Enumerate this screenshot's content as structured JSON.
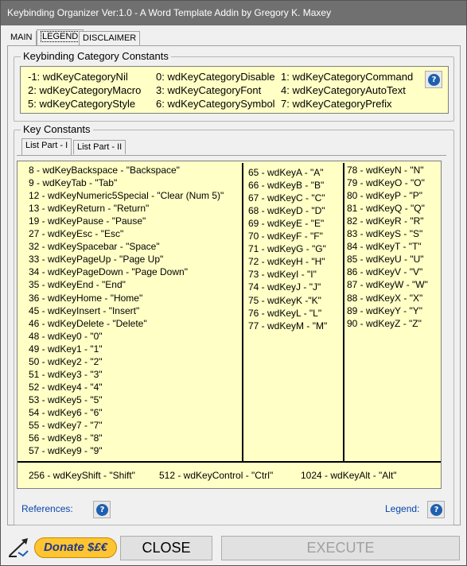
{
  "window": {
    "title": "Keybinding Organizer Ver:1.0 - A Word Template Addin by Gregory K. Maxey"
  },
  "tabs": [
    "MAIN",
    "LEGEND",
    "DISCLAIMER"
  ],
  "category_group": {
    "title": "Keybinding Category Constants",
    "items": [
      "-1: wdKeyCategoryNil",
      "0: wdKeyCategoryDisable",
      "1: wdKeyCategoryCommand",
      "2: wdKeyCategoryMacro",
      "3: wdKeyCategoryFont",
      "4: wdKeyCategoryAutoText",
      "5: wdKeyCategoryStyle",
      "6: wdKeyCategorySymbol",
      "7: wdKeyCategoryPrefix"
    ]
  },
  "key_group": {
    "title": "Key Constants",
    "subtabs": [
      "List Part - I",
      "List Part - II"
    ],
    "col1": [
      "8 - wdKeyBackspace - \"Backspace\"",
      "9 - wdKeyTab - \"Tab\"",
      "12 - wdKeyNumeric5Special - \"Clear (Num 5)\"",
      "13 - wdKeyReturn - \"Return\"",
      "19 - wdKeyPause - \"Pause\"",
      "27 - wdKeyEsc - \"Esc\"",
      "32 - wdKeySpacebar - \"Space\"",
      "33 - wdKeyPageUp - \"Page Up\"",
      "34 - wdKeyPageDown - \"Page Down\"",
      "35 - wdKeyEnd - \"End\"",
      "36 - wdKeyHome - \"Home\"",
      "45 - wdKeyInsert - \"Insert\"",
      "46 - wdKeyDelete - \"Delete\"",
      "48 - wdKey0 - \"0\"",
      "49 - wdKey1 - \"1\"",
      "50 - wdKey2 - \"2\"",
      "51 - wdKey3 - \"3\"",
      "52 - wdKey4 - \"4\"",
      "53 - wdKey5 - \"5\"",
      "54 - wdKey6 - \"6\"",
      "55 - wdKey7 - \"7\"",
      "56 - wdKey8 - \"8\"",
      "57 - wdKey9 - \"9\""
    ],
    "col2": [
      "65 - wdKeyA - \"A\"",
      "66 - wdKeyB - \"B\"",
      "67 - wdKeyC - \"C\"",
      "68 - wdKeyD - \"D\"",
      "69 - wdKeyE - \"E\"",
      "70 - wdKeyF - \"F\"",
      "71 - wdKeyG - \"G\"",
      "72 - wdKeyH - \"H\"",
      "73 - wdKeyI - \"I\"",
      "74 - wdKeyJ - \"J\"",
      "75 - wdKeyK -\"K\"",
      "76 - wdKeyL - \"L\"",
      "77 - wdKeyM - \"M\""
    ],
    "col3": [
      "78 - wdKeyN - \"N\"",
      "79 - wdKeyO - \"O\"",
      "80 - wdKeyP  - \"P\"",
      "81 - wdKeyQ - \"Q\"",
      "82 - wdKeyR - \"R\"",
      "83 - wdKeyS - \"S\"",
      "84 - wdKeyT - \"T\"",
      "85 - wdKeyU - \"U\"",
      "86 - wdKeyV - \"V\"",
      "87 - wdKeyW - \"W\"",
      "88 - wdKeyX - \"X\"",
      "89 - wdKeyY - \"Y\"",
      "90 - wdKeyZ - \"Z\""
    ],
    "modifiers": [
      "256 - wdKeyShift - \"Shift\"",
      "512 - wdKeyControl  - \"Ctrl\"",
      "1024 - wdKeyAlt - \"Alt\""
    ]
  },
  "bottom": {
    "references_label": "References:",
    "legend_label": "Legend:"
  },
  "help_icon": "?",
  "footer": {
    "donate_label": "Donate $£€",
    "close_label": "CLOSE",
    "execute_label": "EXECUTE"
  },
  "colors": {
    "panel_yellow": "#ffffc6",
    "title_bar": "#707070",
    "link_blue": "#0645ad",
    "donate_gold": "#ffc431"
  }
}
